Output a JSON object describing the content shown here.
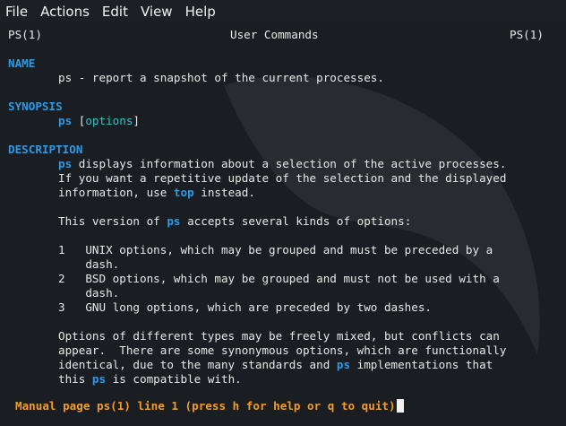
{
  "menubar": {
    "items": [
      "File",
      "Actions",
      "Edit",
      "View",
      "Help"
    ]
  },
  "man": {
    "header_left": "PS(1)",
    "header_center": "User Commands",
    "header_right": "PS(1)",
    "name_heading": "NAME",
    "name_text": "ps - report a snapshot of the current processes.",
    "synopsis_heading": "SYNOPSIS",
    "synopsis_cmd": "ps",
    "synopsis_open": " [",
    "synopsis_opt": "options",
    "synopsis_close": "]",
    "description_heading": "DESCRIPTION",
    "desc1_cmd": "ps",
    "desc1_rest": " displays information about a selection of the active processes.",
    "desc2": "If you want a repetitive update of the selection and the displayed",
    "desc3_pre": "information, use ",
    "desc3_cmd": "top",
    "desc3_post": " instead.",
    "version_pre": "This version of ",
    "version_cmd": "ps",
    "version_post": " accepts several kinds of options:",
    "opt1_a": "1   UNIX options, which may be grouped and must be preceded by a",
    "opt1_b": "    dash.",
    "opt2_a": "2   BSD options, which may be grouped and must not be used with a",
    "opt2_b": "    dash.",
    "opt3": "3   GNU long options, which are preceded by two dashes.",
    "mix1": "Options of different types may be freely mixed, but conflicts can",
    "mix2": "appear.  There are some synonymous options, which are functionally",
    "mix3_pre": "identical, due to the many standards and ",
    "mix3_cmd": "ps",
    "mix3_post": " implementations that",
    "mix4_pre": "this ",
    "mix4_cmd": "ps",
    "mix4_post": " is compatible with.",
    "status": "Manual page ps(1) line 1 (press h for help or q to quit)"
  },
  "colors": {
    "background": "#1a1d22",
    "heading": "#2a9be8",
    "option": "#2ec5c9",
    "status": "#f59b23"
  }
}
